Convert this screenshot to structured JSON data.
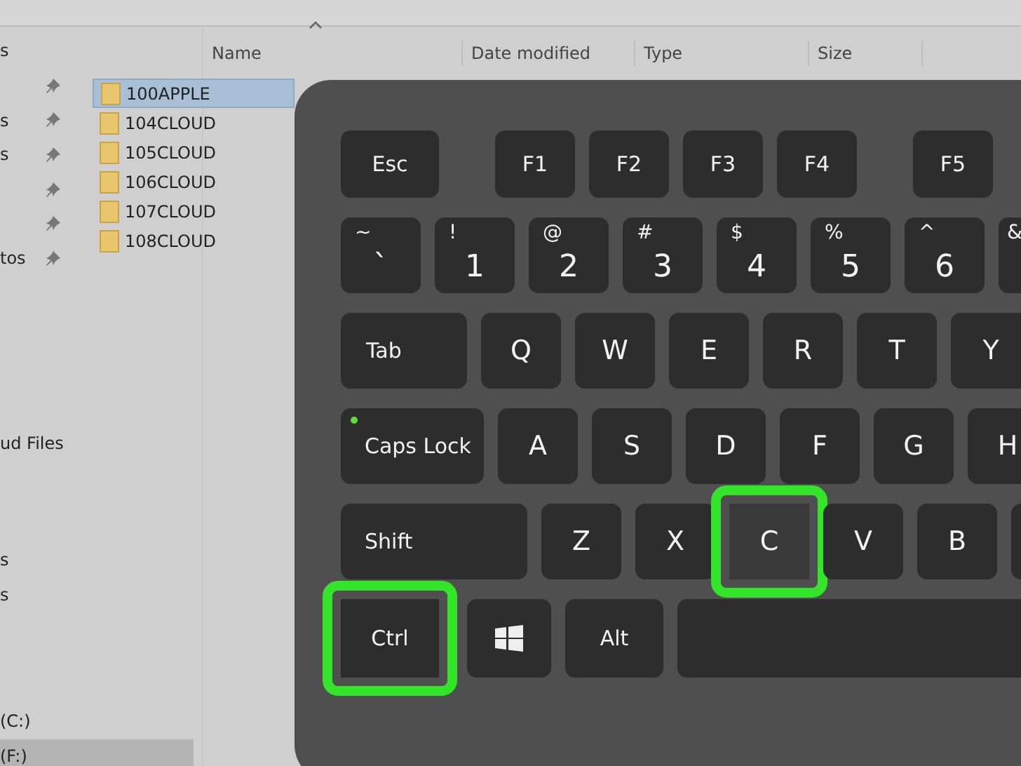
{
  "sidebar": {
    "groups": [
      {
        "items": [
          {
            "text": "s",
            "pinned": false
          },
          {
            "pinned": true
          },
          {
            "text": "s",
            "pinned": true
          },
          {
            "text": "s",
            "pinned": true
          },
          {
            "pinned": true
          },
          {
            "pinned": true
          },
          {
            "text": "tos",
            "pinned": true
          }
        ]
      },
      {
        "items": [
          {
            "text": "ud Files",
            "pinned": false
          }
        ]
      },
      {
        "items": [
          {
            "text": "s",
            "pinned": false
          },
          {
            "text": "s",
            "pinned": false
          }
        ]
      },
      {
        "items": [
          {
            "text": "(C:)",
            "pinned": false,
            "selected": false
          },
          {
            "text": "(F:)",
            "pinned": false,
            "selected": true
          }
        ]
      }
    ]
  },
  "file_list": {
    "columns": [
      "Name",
      "Date modified",
      "Type",
      "Size"
    ],
    "rows": [
      {
        "name": "100APPLE",
        "selected": true
      },
      {
        "name": "104CLOUD",
        "selected": false
      },
      {
        "name": "105CLOUD",
        "selected": false
      },
      {
        "name": "106CLOUD",
        "selected": false
      },
      {
        "name": "107CLOUD",
        "selected": false
      },
      {
        "name": "108CLOUD",
        "selected": false
      }
    ]
  },
  "keyboard": {
    "rows": [
      [
        {
          "kind": "fn",
          "label": "Esc",
          "highlighted": false
        },
        {
          "kind": "gap"
        },
        {
          "kind": "fn",
          "label": "F1",
          "highlighted": false
        },
        {
          "kind": "fn",
          "label": "F2",
          "highlighted": false
        },
        {
          "kind": "fn",
          "label": "F3",
          "highlighted": false
        },
        {
          "kind": "fn",
          "label": "F4",
          "highlighted": false
        },
        {
          "kind": "gap"
        },
        {
          "kind": "fn",
          "label": "F5",
          "highlighted": false
        }
      ],
      [
        {
          "kind": "dual",
          "label": "`",
          "shift": "~",
          "highlighted": false
        },
        {
          "kind": "dual",
          "label": "1",
          "shift": "!",
          "highlighted": false
        },
        {
          "kind": "dual",
          "label": "2",
          "shift": "@",
          "highlighted": false
        },
        {
          "kind": "dual",
          "label": "3",
          "shift": "#",
          "highlighted": false
        },
        {
          "kind": "dual",
          "label": "4",
          "shift": "$",
          "highlighted": false
        },
        {
          "kind": "dual",
          "label": "5",
          "shift": "%",
          "highlighted": false
        },
        {
          "kind": "dual",
          "label": "6",
          "shift": "^",
          "highlighted": false
        },
        {
          "kind": "edge",
          "shift": "&",
          "highlighted": false
        }
      ],
      [
        {
          "kind": "tab",
          "label": "Tab",
          "highlighted": false
        },
        {
          "kind": "letter",
          "label": "Q",
          "highlighted": false
        },
        {
          "kind": "letter",
          "label": "W",
          "highlighted": false
        },
        {
          "kind": "letter",
          "label": "E",
          "highlighted": false
        },
        {
          "kind": "letter",
          "label": "R",
          "highlighted": false
        },
        {
          "kind": "letter",
          "label": "T",
          "highlighted": false
        },
        {
          "kind": "letter",
          "label": "Y",
          "highlighted": false
        }
      ],
      [
        {
          "kind": "caps",
          "label": "Caps Lock",
          "led": true,
          "highlighted": false
        },
        {
          "kind": "letter",
          "label": "A",
          "highlighted": false
        },
        {
          "kind": "letter",
          "label": "S",
          "highlighted": false
        },
        {
          "kind": "letter",
          "label": "D",
          "highlighted": false
        },
        {
          "kind": "letter",
          "label": "F",
          "highlighted": false
        },
        {
          "kind": "letter",
          "label": "G",
          "highlighted": false
        },
        {
          "kind": "letter",
          "label": "H",
          "highlighted": false
        }
      ],
      [
        {
          "kind": "shift",
          "label": "Shift",
          "highlighted": false
        },
        {
          "kind": "letter",
          "label": "Z",
          "highlighted": false
        },
        {
          "kind": "letter",
          "label": "X",
          "highlighted": false
        },
        {
          "kind": "letter",
          "label": "C",
          "highlighted": true
        },
        {
          "kind": "letter",
          "label": "V",
          "highlighted": false
        },
        {
          "kind": "letter",
          "label": "B",
          "highlighted": false
        },
        {
          "kind": "letter",
          "highlighted": false
        }
      ],
      [
        {
          "kind": "ctrl",
          "label": "Ctrl",
          "highlighted": true
        },
        {
          "kind": "win",
          "highlighted": false
        },
        {
          "kind": "alt",
          "label": "Alt",
          "highlighted": false
        },
        {
          "kind": "space",
          "highlighted": false
        }
      ]
    ]
  }
}
